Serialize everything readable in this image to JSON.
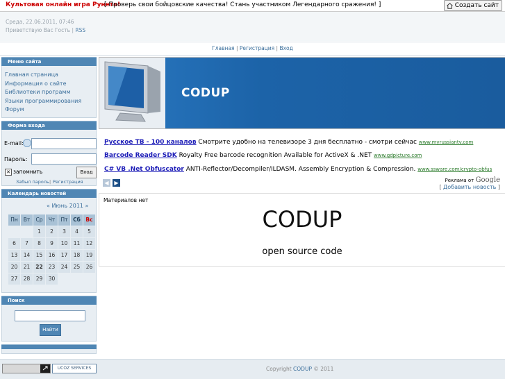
{
  "topbar": {
    "promo": "Культовая онлайн игра Рунета!",
    "slogan": "[ Проверь свои бойцовские качества! Стань участником Легендарного сражения! ]",
    "create_site": "Создать сайт"
  },
  "header": {
    "date": "Среда, 22.06.2011, 07:46",
    "greeting": "Приветствую Вас Гость",
    "rss": "RSS"
  },
  "nav": {
    "home": "Главная",
    "register": "Регистрация",
    "login": "Вход"
  },
  "menu": {
    "title": "Меню сайта",
    "items": [
      "Главная страница",
      "Информация о сайте",
      "Библиотеки программ",
      "Языки программирования",
      "Форум"
    ]
  },
  "login_form": {
    "title": "Форма входа",
    "email_label": "E-mail:",
    "password_label": "Пароль:",
    "remember": "запомнить",
    "submit": "Вход",
    "forgot": "Забыл пароль",
    "register": "Регистрация"
  },
  "calendar": {
    "title": "Календарь новостей",
    "month": "« Июнь 2011 »",
    "headers": [
      "Пн",
      "Вт",
      "Ср",
      "Чт",
      "Пт",
      "Сб",
      "Вс"
    ],
    "weeks": [
      [
        "",
        "",
        "1",
        "2",
        "3",
        "4",
        "5"
      ],
      [
        "6",
        "7",
        "8",
        "9",
        "10",
        "11",
        "12"
      ],
      [
        "13",
        "14",
        "15",
        "16",
        "17",
        "18",
        "19"
      ],
      [
        "20",
        "21",
        "22",
        "23",
        "24",
        "25",
        "26"
      ],
      [
        "27",
        "28",
        "29",
        "30",
        "",
        "",
        ""
      ]
    ],
    "today": "22"
  },
  "search": {
    "title": "Поиск",
    "button": "Найти"
  },
  "banner": {
    "title": "CODUP"
  },
  "ads": [
    {
      "title": "Русское ТВ - 100 каналов",
      "text": "Смотрите удобно на телевизоре 3 дня бесплатно - смотри сейчас",
      "url": "www.myrussiantv.com"
    },
    {
      "title": "Barcode Reader SDK",
      "text": "Royalty Free barcode recognition Available for ActiveX & .NET",
      "url": "www.gdpicture.com"
    },
    {
      "title": "C# VB .Net Obfuscator",
      "text": "ANTI-Reflector/Decompiler/ILDASM. Assembly Encryption & Compression.",
      "url": "www.ssware.com/crypto-obfus"
    }
  ],
  "ads_by": "Реклама от",
  "ads_google": "Google",
  "add_news": "Добавить новость",
  "content": {
    "empty": "Материалов нет",
    "big": "CODUP",
    "sub": "open source code"
  },
  "footer": {
    "copyright_prefix": "Copyright",
    "brand": "CODUP",
    "copyright_suffix": "© 2011",
    "ucoz_badge": "UCOZ SERVICES"
  },
  "colors": {
    "block_title": "#4f86b4",
    "banner_bg": "#1c63a8",
    "link": "#3a6e9b",
    "promo": "#cc0000"
  }
}
